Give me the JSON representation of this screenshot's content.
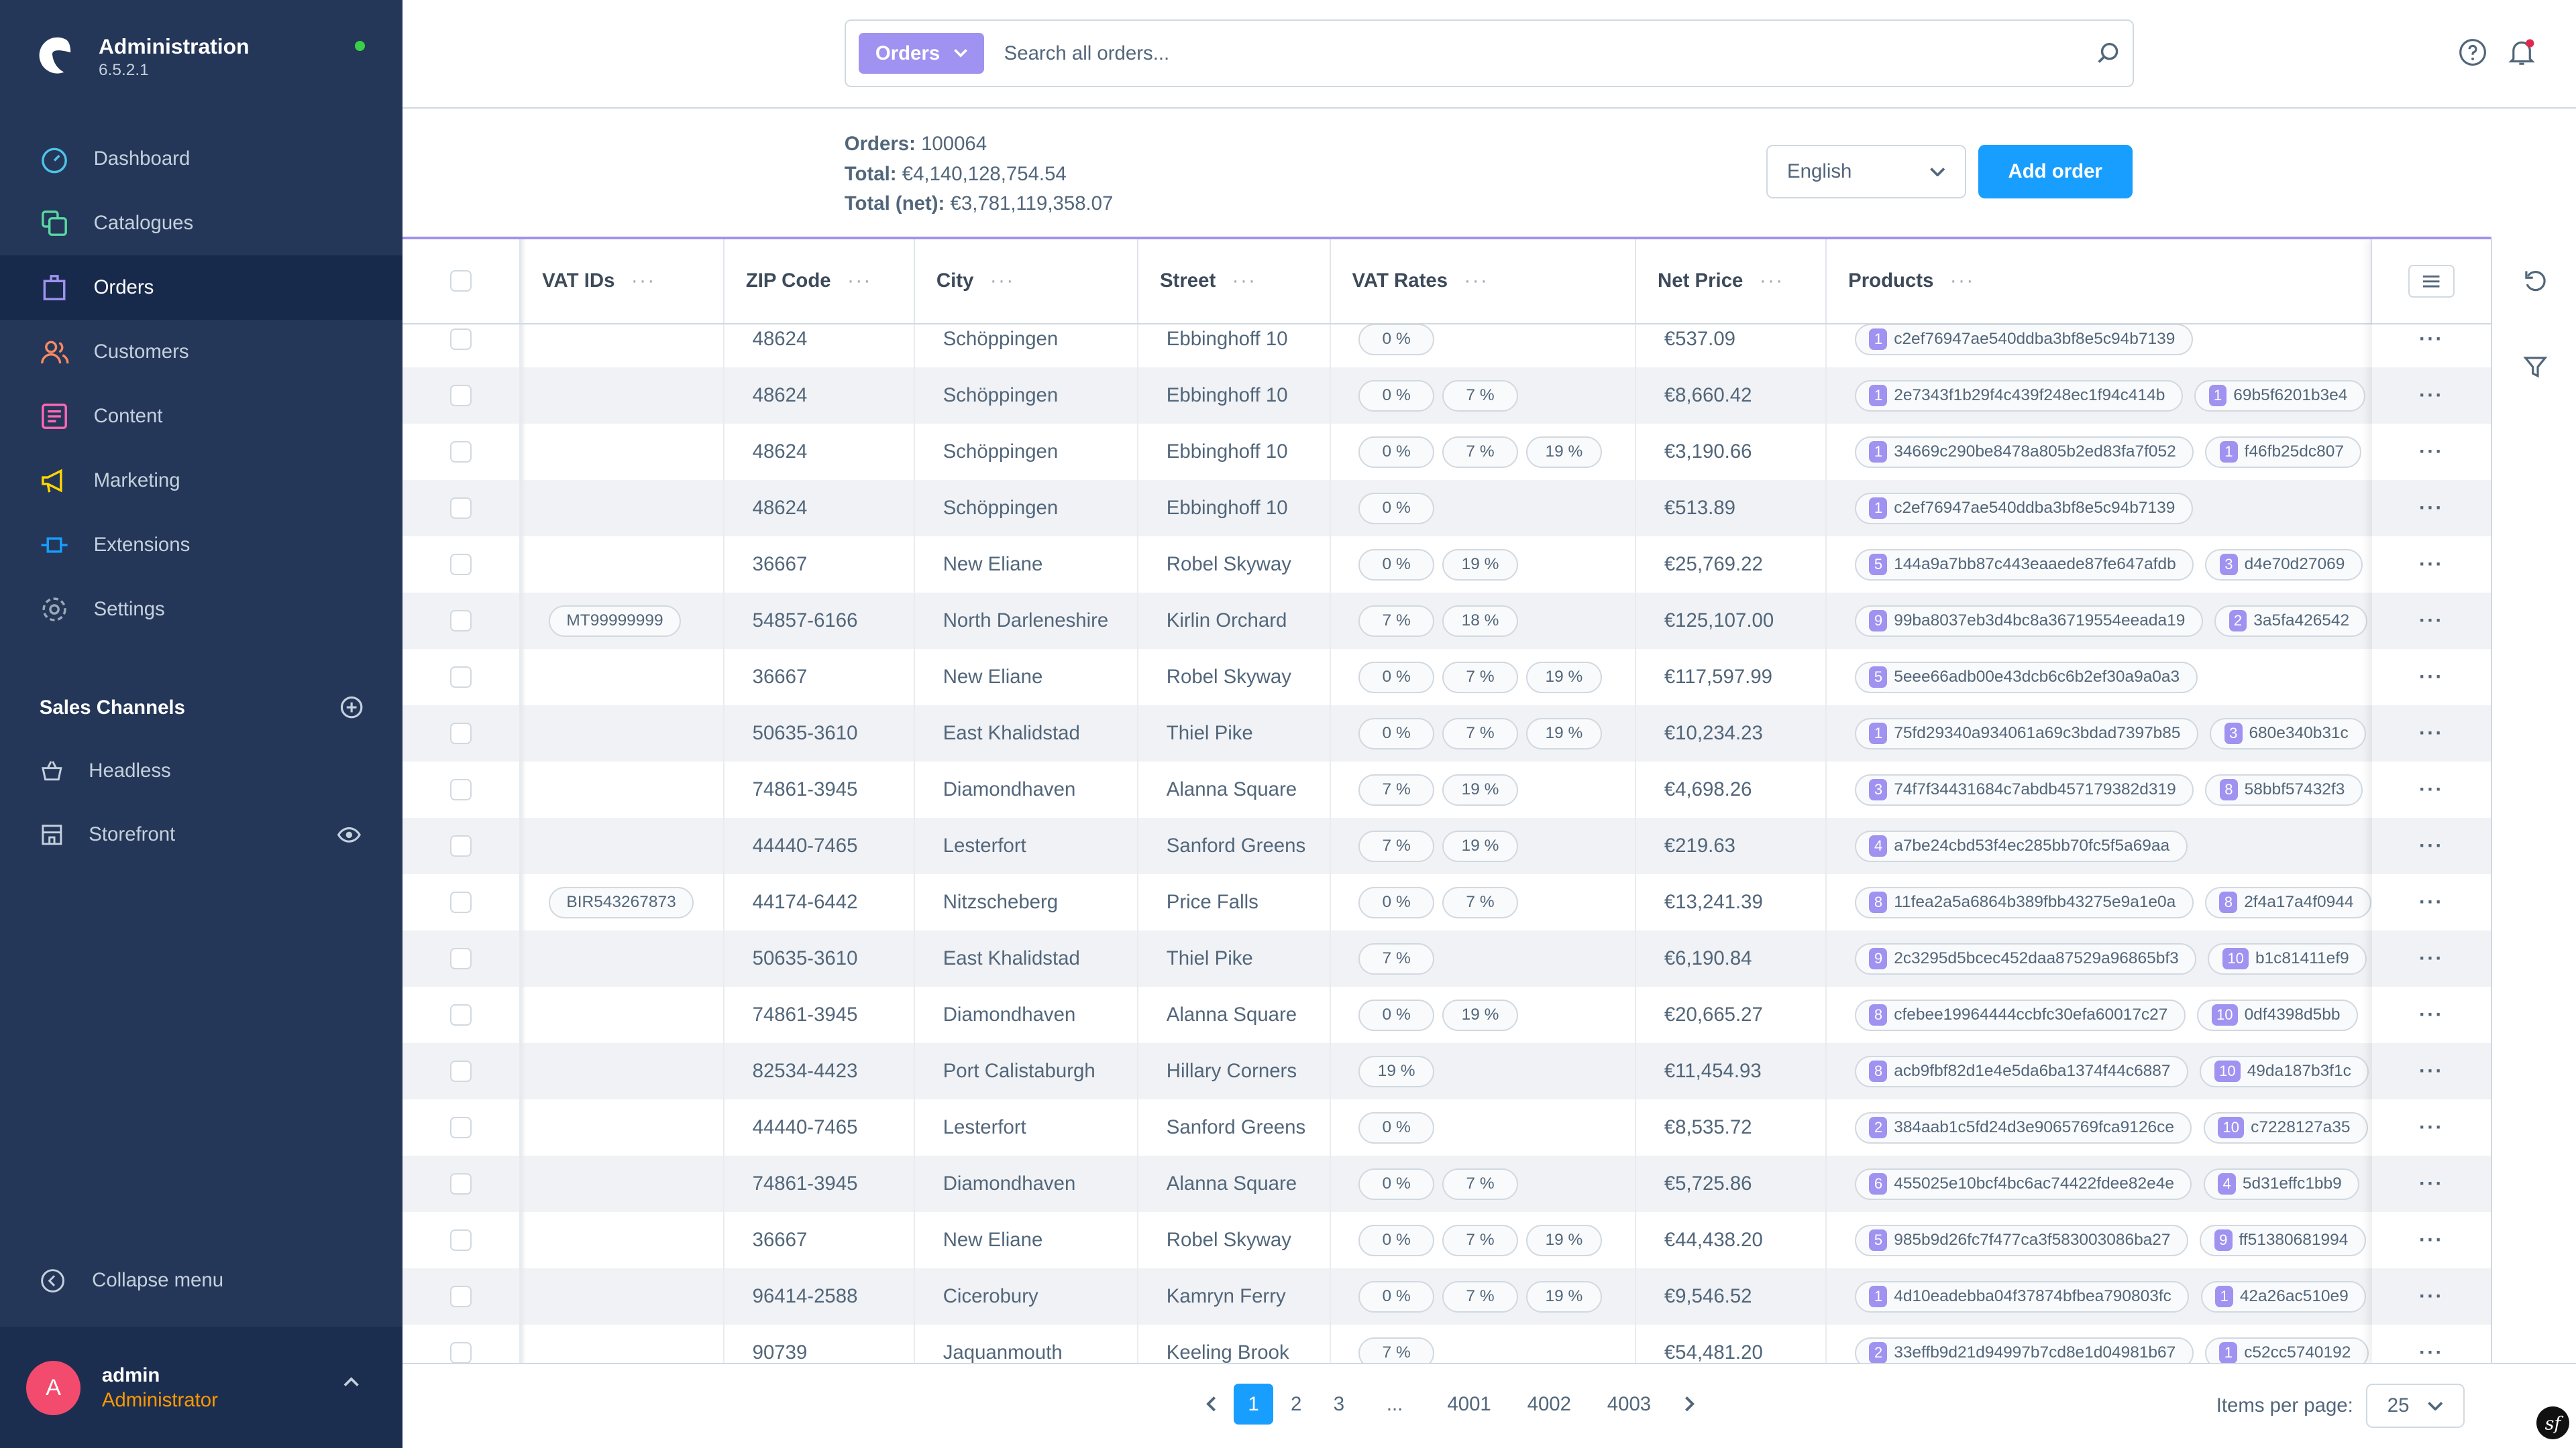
{
  "app": {
    "title": "Administration",
    "version": "6.5.2.1",
    "status_color": "#37d046"
  },
  "nav": [
    {
      "label": "Dashboard",
      "icon": "dashboard-icon",
      "color": "#4fc3e8"
    },
    {
      "label": "Catalogues",
      "icon": "catalogues-icon",
      "color": "#57d9a3"
    },
    {
      "label": "Orders",
      "icon": "orders-icon",
      "color": "#a092f0",
      "active": true
    },
    {
      "label": "Customers",
      "icon": "customers-icon",
      "color": "#f88962"
    },
    {
      "label": "Content",
      "icon": "content-icon",
      "color": "#ff68b4"
    },
    {
      "label": "Marketing",
      "icon": "marketing-icon",
      "color": "#ffd700"
    },
    {
      "label": "Extensions",
      "icon": "extensions-icon",
      "color": "#189eff"
    },
    {
      "label": "Settings",
      "icon": "settings-icon",
      "color": "#9aa8b5"
    }
  ],
  "sales_channels": {
    "title": "Sales Channels",
    "items": [
      {
        "label": "Headless"
      },
      {
        "label": "Storefront"
      }
    ]
  },
  "collapse_label": "Collapse menu",
  "user": {
    "initial": "A",
    "name": "admin",
    "role": "Administrator"
  },
  "search": {
    "type": "Orders",
    "placeholder": "Search all orders..."
  },
  "summary": {
    "orders_label": "Orders:",
    "orders": "100064",
    "total_label": "Total:",
    "total": "€4,140,128,754.54",
    "net_label": "Total (net):",
    "net": "€3,781,119,358.07"
  },
  "language": "English",
  "add_order": "Add order",
  "columns": [
    "VAT IDs",
    "ZIP Code",
    "City",
    "Street",
    "VAT Rates",
    "Net Price",
    "Products"
  ],
  "rows": [
    {
      "vat": "",
      "zip": "48624",
      "city": "Schöppingen",
      "street": "Ebbinghoff 10",
      "rates": [
        "0 %"
      ],
      "net": "€537.09",
      "products": [
        [
          "1",
          "c2ef76947ae540ddba3bf8e5c94b7139"
        ]
      ]
    },
    {
      "vat": "",
      "zip": "48624",
      "city": "Schöppingen",
      "street": "Ebbinghoff 10",
      "rates": [
        "0 %",
        "7 %"
      ],
      "net": "€8,660.42",
      "products": [
        [
          "1",
          "2e7343f1b29f4c439f248ec1f94c414b"
        ],
        [
          "1",
          "69b5f6201b3e4"
        ]
      ]
    },
    {
      "vat": "",
      "zip": "48624",
      "city": "Schöppingen",
      "street": "Ebbinghoff 10",
      "rates": [
        "0 %",
        "7 %",
        "19 %"
      ],
      "net": "€3,190.66",
      "products": [
        [
          "1",
          "34669c290be8478a805b2ed83fa7f052"
        ],
        [
          "1",
          "f46fb25dc807"
        ]
      ]
    },
    {
      "vat": "",
      "zip": "48624",
      "city": "Schöppingen",
      "street": "Ebbinghoff 10",
      "rates": [
        "0 %"
      ],
      "net": "€513.89",
      "products": [
        [
          "1",
          "c2ef76947ae540ddba3bf8e5c94b7139"
        ]
      ]
    },
    {
      "vat": "",
      "zip": "36667",
      "city": "New Eliane",
      "street": "Robel Skyway",
      "rates": [
        "0 %",
        "19 %"
      ],
      "net": "€25,769.22",
      "products": [
        [
          "5",
          "144a9a7bb87c443eaaede87fe647afdb"
        ],
        [
          "3",
          "d4e70d27069"
        ]
      ]
    },
    {
      "vat": "MT99999999",
      "zip": "54857-6166",
      "city": "North Darleneshire",
      "street": "Kirlin Orchard",
      "rates": [
        "7 %",
        "18 %"
      ],
      "net": "€125,107.00",
      "products": [
        [
          "9",
          "99ba8037eb3d4bc8a36719554eeada19"
        ],
        [
          "2",
          "3a5fa426542"
        ]
      ]
    },
    {
      "vat": "",
      "zip": "36667",
      "city": "New Eliane",
      "street": "Robel Skyway",
      "rates": [
        "0 %",
        "7 %",
        "19 %"
      ],
      "net": "€117,597.99",
      "products": [
        [
          "5",
          "5eee66adb00e43dcb6c6b2ef30a9a0a3"
        ]
      ]
    },
    {
      "vat": "",
      "zip": "50635-3610",
      "city": "East Khalidstad",
      "street": "Thiel Pike",
      "rates": [
        "0 %",
        "7 %",
        "19 %"
      ],
      "net": "€10,234.23",
      "products": [
        [
          "1",
          "75fd29340a934061a69c3bdad7397b85"
        ],
        [
          "3",
          "680e340b31c"
        ]
      ]
    },
    {
      "vat": "",
      "zip": "74861-3945",
      "city": "Diamondhaven",
      "street": "Alanna Square",
      "rates": [
        "7 %",
        "19 %"
      ],
      "net": "€4,698.26",
      "products": [
        [
          "3",
          "74f7f34431684c7abdb457179382d319"
        ],
        [
          "8",
          "58bbf57432f3"
        ]
      ]
    },
    {
      "vat": "",
      "zip": "44440-7465",
      "city": "Lesterfort",
      "street": "Sanford Greens",
      "rates": [
        "7 %",
        "19 %"
      ],
      "net": "€219.63",
      "products": [
        [
          "4",
          "a7be24cbd53f4ec285bb70fc5f5a69aa"
        ]
      ]
    },
    {
      "vat": "BIR543267873",
      "zip": "44174-6442",
      "city": "Nitzscheberg",
      "street": "Price Falls",
      "rates": [
        "0 %",
        "7 %"
      ],
      "net": "€13,241.39",
      "products": [
        [
          "8",
          "11fea2a5a6864b389fbb43275e9a1e0a"
        ],
        [
          "8",
          "2f4a17a4f0944"
        ]
      ]
    },
    {
      "vat": "",
      "zip": "50635-3610",
      "city": "East Khalidstad",
      "street": "Thiel Pike",
      "rates": [
        "7 %"
      ],
      "net": "€6,190.84",
      "products": [
        [
          "9",
          "2c3295d5bcec452daa87529a96865bf3"
        ],
        [
          "10",
          "b1c81411ef9"
        ]
      ]
    },
    {
      "vat": "",
      "zip": "74861-3945",
      "city": "Diamondhaven",
      "street": "Alanna Square",
      "rates": [
        "0 %",
        "19 %"
      ],
      "net": "€20,665.27",
      "products": [
        [
          "8",
          "cfebee19964444ccbfc30efa60017c27"
        ],
        [
          "10",
          "0df4398d5bb"
        ]
      ]
    },
    {
      "vat": "",
      "zip": "82534-4423",
      "city": "Port Calistaburgh",
      "street": "Hillary Corners",
      "rates": [
        "19 %"
      ],
      "net": "€11,454.93",
      "products": [
        [
          "8",
          "acb9fbf82d1e4e5da6ba1374f44c6887"
        ],
        [
          "10",
          "49da187b3f1c"
        ]
      ]
    },
    {
      "vat": "",
      "zip": "44440-7465",
      "city": "Lesterfort",
      "street": "Sanford Greens",
      "rates": [
        "0 %"
      ],
      "net": "€8,535.72",
      "products": [
        [
          "2",
          "384aab1c5fd24d3e9065769fca9126ce"
        ],
        [
          "10",
          "c7228127a35"
        ]
      ]
    },
    {
      "vat": "",
      "zip": "74861-3945",
      "city": "Diamondhaven",
      "street": "Alanna Square",
      "rates": [
        "0 %",
        "7 %"
      ],
      "net": "€5,725.86",
      "products": [
        [
          "6",
          "455025e10bcf4bc6ac74422fdee82e4e"
        ],
        [
          "4",
          "5d31effc1bb9"
        ]
      ]
    },
    {
      "vat": "",
      "zip": "36667",
      "city": "New Eliane",
      "street": "Robel Skyway",
      "rates": [
        "0 %",
        "7 %",
        "19 %"
      ],
      "net": "€44,438.20",
      "products": [
        [
          "5",
          "985b9d26fc7f477ca3f583003086ba27"
        ],
        [
          "9",
          "ff51380681994"
        ]
      ]
    },
    {
      "vat": "",
      "zip": "96414-2588",
      "city": "Cicerobury",
      "street": "Kamryn Ferry",
      "rates": [
        "0 %",
        "7 %",
        "19 %"
      ],
      "net": "€9,546.52",
      "products": [
        [
          "1",
          "4d10eadebba04f37874bfbea790803fc"
        ],
        [
          "1",
          "42a26ac510e9"
        ]
      ]
    },
    {
      "vat": "",
      "zip": "90739",
      "city": "Jaquanmouth",
      "street": "Keeling Brook",
      "rates": [
        "7 %"
      ],
      "net": "€54,481.20",
      "products": [
        [
          "2",
          "33effb9d21d94997b7cd8e1d04981b67"
        ],
        [
          "1",
          "c52cc5740192"
        ]
      ]
    }
  ],
  "pagination": {
    "pages": [
      "1",
      "2",
      "3",
      "...",
      "4001",
      "4002",
      "4003"
    ],
    "current": "1",
    "items_per_page_label": "Items per page:",
    "items_per_page": "25"
  },
  "colors": {
    "sidebar": "#243758",
    "accent": "#189eff",
    "search_type": "#a092f0"
  }
}
